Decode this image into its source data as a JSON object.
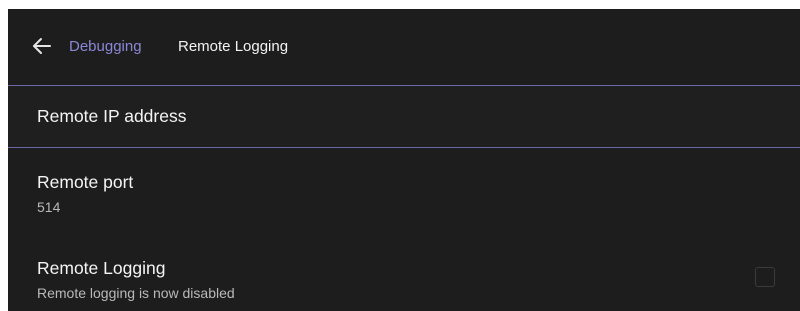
{
  "header": {
    "back_icon": "arrow-left-icon",
    "breadcrumb_parent": "Debugging",
    "breadcrumb_current": "Remote Logging"
  },
  "settings": {
    "remote_ip": {
      "title": "Remote IP address"
    },
    "remote_port": {
      "title": "Remote port",
      "value": "514"
    },
    "remote_logging": {
      "title": "Remote Logging",
      "status": "Remote logging is now disabled",
      "checked": false
    }
  },
  "colors": {
    "background": "#1d1d1d",
    "accent": "#8b87d6",
    "selection_border": "#6a6aa8",
    "subtext": "#b9b9b9"
  }
}
